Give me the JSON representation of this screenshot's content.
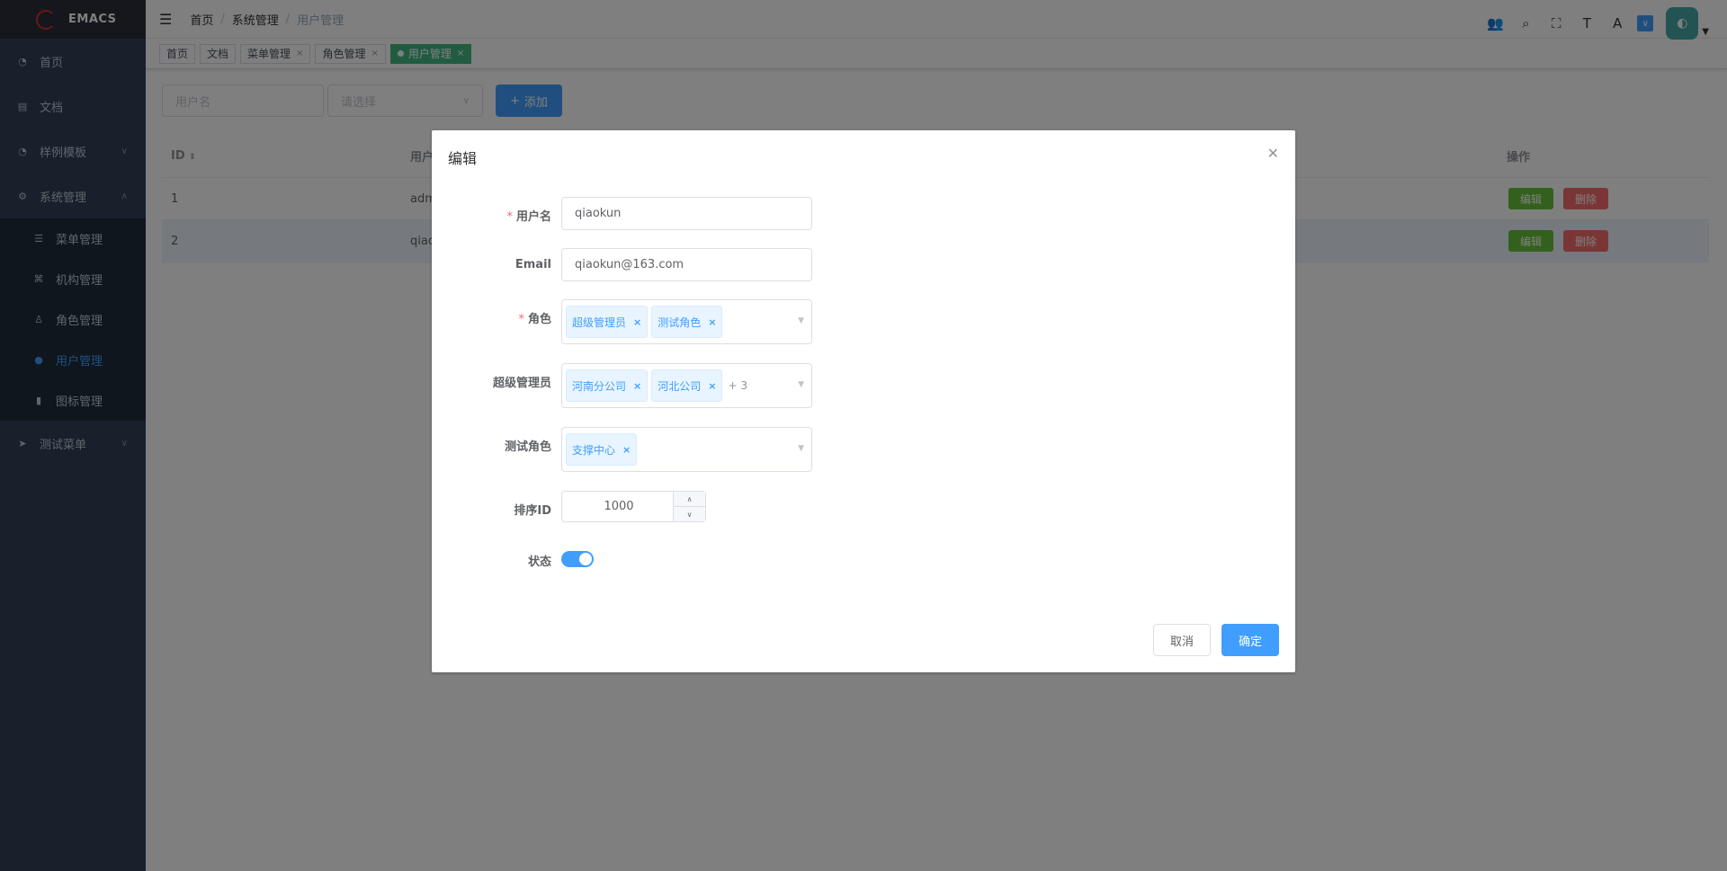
{
  "app": {
    "logo_text": "EMACS"
  },
  "sidebar": {
    "items": [
      {
        "label": "首页",
        "icon": "dashboard-icon"
      },
      {
        "label": "文档",
        "icon": "document-icon"
      },
      {
        "label": "样例模板",
        "icon": "dashboard-icon"
      },
      {
        "label": "系统管理",
        "icon": "settings-icon"
      },
      {
        "label": "测试菜单",
        "icon": "send-icon"
      }
    ],
    "sub_items": [
      {
        "label": "菜单管理",
        "icon": "list-icon"
      },
      {
        "label": "机构管理",
        "icon": "tree-icon"
      },
      {
        "label": "角色管理",
        "icon": "role-icon"
      },
      {
        "label": "用户管理",
        "icon": "user-icon"
      },
      {
        "label": "图标管理",
        "icon": "info-icon"
      }
    ],
    "active_color": "#409eff"
  },
  "breadcrumb": {
    "home": "首页",
    "section": "系统管理",
    "current": "用户管理"
  },
  "tags": [
    {
      "label": "首页"
    },
    {
      "label": "文档"
    },
    {
      "label": "菜单管理"
    },
    {
      "label": "角色管理"
    },
    {
      "label": "用户管理"
    }
  ],
  "toolbar": {
    "username_placeholder": "用户名",
    "select_placeholder": "请选择",
    "add_label": "添加"
  },
  "table": {
    "headers": {
      "id": "ID",
      "user": "用户",
      "ops": "操作"
    },
    "rows": [
      {
        "id": "1",
        "user": "adm"
      },
      {
        "id": "2",
        "user": "qiao"
      }
    ],
    "edit_label": "编辑",
    "delete_label": "删除"
  },
  "dialog": {
    "title": "编辑",
    "fields": {
      "username": {
        "label": "用户名",
        "value": "qiaokun"
      },
      "email": {
        "label": "Email",
        "value": "qiaokun@163.com"
      },
      "role": {
        "label": "角色",
        "chips": [
          "超级管理员",
          "测试角色"
        ]
      },
      "super_admin": {
        "label": "超级管理员",
        "chips": [
          "河南分公司",
          "河北公司"
        ],
        "more": "+ 3"
      },
      "test_role": {
        "label": "测试角色",
        "chips": [
          "支撑中心"
        ]
      },
      "sort_id": {
        "label": "排序ID",
        "value": "1000"
      },
      "status": {
        "label": "状态",
        "enabled": true
      }
    },
    "cancel_label": "取消",
    "ok_label": "确定"
  },
  "colors": {
    "primary": "#409eff",
    "success": "#67c23a",
    "danger": "#f56c6c",
    "tag_active": "#42b983",
    "sidebar_bg": "#304156"
  }
}
